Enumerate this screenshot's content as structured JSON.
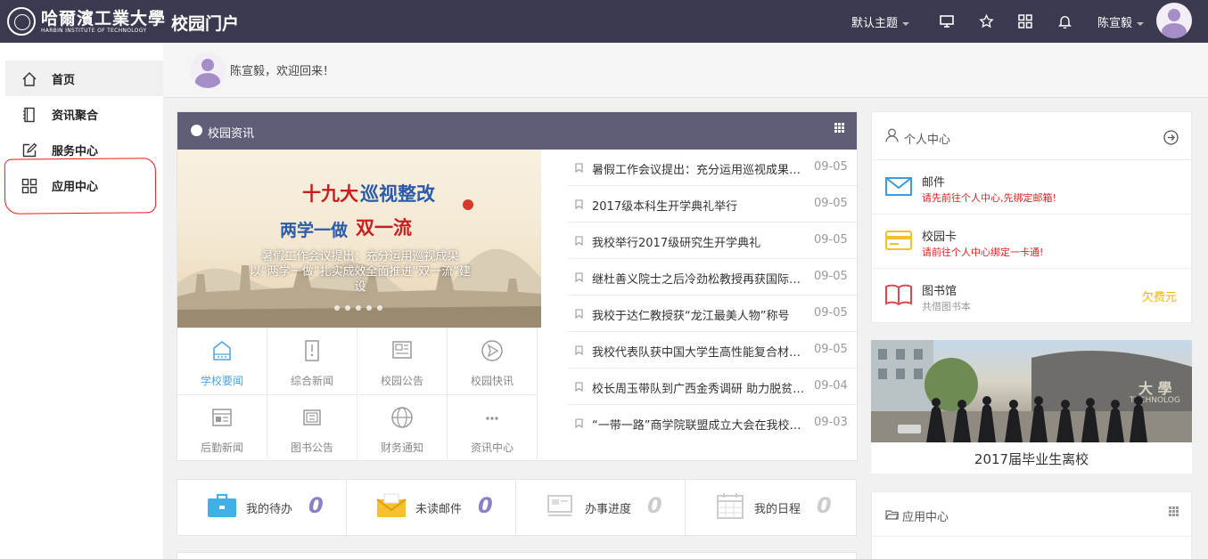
{
  "header": {
    "logo_cn": "哈爾濱工業大學",
    "logo_en": "HARBIN INSTITUTE OF TECHNOLOGY",
    "portal_title": "校园门户",
    "theme_label": "默认主题",
    "icons": [
      "monitor-icon",
      "star-icon",
      "grid-icon",
      "bell-icon"
    ],
    "username": "陈宣毅"
  },
  "sidebar": {
    "items": [
      {
        "label": "首页",
        "icon": "home-icon"
      },
      {
        "label": "资讯聚合",
        "icon": "notebook-icon"
      },
      {
        "label": "服务中心",
        "icon": "edit-icon"
      },
      {
        "label": "应用中心",
        "icon": "apps-icon"
      }
    ],
    "active_index": 0,
    "annotation_color": "#e21b1b"
  },
  "welcome": {
    "text": "陈宣毅，欢迎回来！"
  },
  "news_panel": {
    "title": "校园资讯",
    "banner": {
      "line1_red": "十九大",
      "line1_blue": "巡视整改",
      "line2_blue": "两学一做",
      "line2_red": "双一流",
      "caption": "暑假工作会议提出：充分运用巡视成果以“两学一做”扎实成效全面推进“双一流”建设"
    },
    "categories": [
      {
        "label": "学校要闻",
        "icon": "building-icon",
        "active": true
      },
      {
        "label": "综合新闻",
        "icon": "door-icon",
        "active": false
      },
      {
        "label": "校园公告",
        "icon": "notice-icon",
        "active": false
      },
      {
        "label": "校园快讯",
        "icon": "send-icon",
        "active": false
      },
      {
        "label": "后勤新闻",
        "icon": "list-window-icon",
        "active": false
      },
      {
        "label": "图书公告",
        "icon": "books-icon",
        "active": false
      },
      {
        "label": "财务通知",
        "icon": "globe-icon",
        "active": false
      },
      {
        "label": "资讯中心",
        "icon": "more-icon",
        "active": false
      }
    ],
    "items": [
      {
        "title": "暑假工作会议提出：充分运用巡视成果以“两学一做”扎实成效全面推进",
        "date": "09-05"
      },
      {
        "title": "2017级本科生开学典礼举行",
        "date": "09-05"
      },
      {
        "title": "我校举行2017级研究生开学典礼",
        "date": "09-05"
      },
      {
        "title": "继杜善义院士之后冷劲松教授再获国际复合材料学会世界会士",
        "date": "09-05"
      },
      {
        "title": "我校于达仁教授获“龙江最美人物”称号",
        "date": "09-05"
      },
      {
        "title": "我校代表队获中国大学生高性能复合材料大赛冠军",
        "date": "09-05"
      },
      {
        "title": "校长周玉带队到广西金秀调研 助力脱贫攻坚",
        "date": "09-04"
      },
      {
        "title": "“一带一路”商学院联盟成立大会在我校召开",
        "date": "09-03"
      }
    ]
  },
  "stats": [
    {
      "label": "我的待办",
      "value": "0",
      "icon": "briefcase-icon",
      "grey": false
    },
    {
      "label": "未读邮件",
      "value": "0",
      "icon": "envelope-icon",
      "grey": false
    },
    {
      "label": "办事进度",
      "value": "0",
      "icon": "progress-icon",
      "grey": true
    },
    {
      "label": "我的日程",
      "value": "0",
      "icon": "calendar-icon",
      "grey": true
    }
  ],
  "personal": {
    "title": "个人中心",
    "items": [
      {
        "name": "邮件",
        "sub": "请先前往个人中心,先绑定邮箱!",
        "icon": "mail-icon"
      },
      {
        "name": "校园卡",
        "sub": "请前往个人中心绑定一卡通!",
        "icon": "card-icon"
      },
      {
        "name": "图书馆",
        "sub": "共借图书本",
        "icon": "book-icon",
        "owe": "欠费元"
      }
    ]
  },
  "photo": {
    "caption": "2017届毕业生离校"
  },
  "apps": {
    "title": "应用中心"
  }
}
